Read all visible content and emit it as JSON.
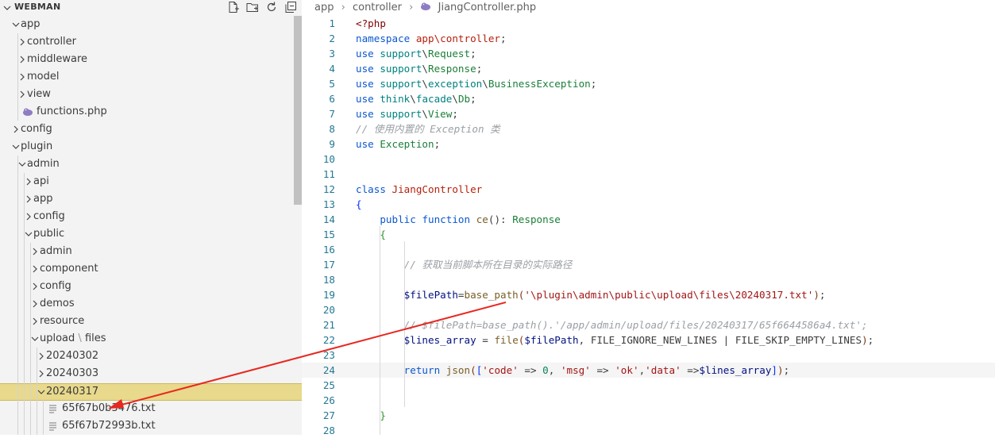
{
  "sidebar": {
    "title": "WEBMAN",
    "header_icons": [
      "new-file-icon",
      "new-folder-icon",
      "refresh-icon",
      "collapse-all-icon"
    ],
    "tree": [
      {
        "label": "app",
        "indent": 0,
        "type": "folder",
        "expanded": true
      },
      {
        "label": "controller",
        "indent": 1,
        "type": "folder",
        "expanded": false
      },
      {
        "label": "middleware",
        "indent": 1,
        "type": "folder",
        "expanded": false
      },
      {
        "label": "model",
        "indent": 1,
        "type": "folder",
        "expanded": false
      },
      {
        "label": "view",
        "indent": 1,
        "type": "folder",
        "expanded": false
      },
      {
        "label": "functions.php",
        "indent": 1,
        "type": "php"
      },
      {
        "label": "config",
        "indent": 0,
        "type": "folder",
        "expanded": false
      },
      {
        "label": "plugin",
        "indent": 0,
        "type": "folder",
        "expanded": true
      },
      {
        "label": "admin",
        "indent": 1,
        "type": "folder",
        "expanded": true
      },
      {
        "label": "api",
        "indent": 2,
        "type": "folder",
        "expanded": false
      },
      {
        "label": "app",
        "indent": 2,
        "type": "folder",
        "expanded": false
      },
      {
        "label": "config",
        "indent": 2,
        "type": "folder",
        "expanded": false
      },
      {
        "label": "public",
        "indent": 2,
        "type": "folder",
        "expanded": true
      },
      {
        "label": "admin",
        "indent": 3,
        "type": "folder",
        "expanded": false
      },
      {
        "label": "component",
        "indent": 3,
        "type": "folder",
        "expanded": false
      },
      {
        "label": "config",
        "indent": 3,
        "type": "folder",
        "expanded": false
      },
      {
        "label": "demos",
        "indent": 3,
        "type": "folder",
        "expanded": false
      },
      {
        "label": "resource",
        "indent": 3,
        "type": "folder",
        "expanded": false
      },
      {
        "label": "upload",
        "label2": "files",
        "indent": 3,
        "type": "folder",
        "expanded": true
      },
      {
        "label": "20240302",
        "indent": 4,
        "type": "folder",
        "expanded": false
      },
      {
        "label": "20240303",
        "indent": 4,
        "type": "folder",
        "expanded": false
      },
      {
        "label": "20240317",
        "indent": 4,
        "type": "folder",
        "expanded": true,
        "selected": true
      },
      {
        "label": "65f67b0b3476.txt",
        "indent": 5,
        "type": "txt"
      },
      {
        "label": "65f67b72993b.txt",
        "indent": 5,
        "type": "txt"
      }
    ]
  },
  "breadcrumb": {
    "items": [
      "app",
      "controller",
      "JiangController.php"
    ]
  },
  "editor": {
    "lines": [
      {
        "n": "1",
        "html": "<span class=\"php\">&lt;?php</span>"
      },
      {
        "n": "2",
        "html": "<span class=\"kb\">namespace</span> <span class=\"cls\">app\\controller</span><span class=\"p\">;</span>"
      },
      {
        "n": "3",
        "html": "<span class=\"kb\">use</span> <span class=\"pk\">support</span><span class=\"p\">\\</span><span class=\"str\">Request</span><span class=\"p\">;</span>"
      },
      {
        "n": "4",
        "html": "<span class=\"kb\">use</span> <span class=\"pk\">support</span><span class=\"p\">\\</span><span class=\"str\">Response</span><span class=\"p\">;</span>"
      },
      {
        "n": "5",
        "html": "<span class=\"kb\">use</span> <span class=\"pk\">support</span><span class=\"p\">\\</span><span class=\"pk\">exception</span><span class=\"p\">\\</span><span class=\"str\">BusinessException</span><span class=\"p\">;</span>"
      },
      {
        "n": "6",
        "html": "<span class=\"kb\">use</span> <span class=\"pk\">think</span><span class=\"p\">\\</span><span class=\"pk\">facade</span><span class=\"p\">\\</span><span class=\"str\">Db</span><span class=\"p\">;</span>"
      },
      {
        "n": "7",
        "html": "<span class=\"kb\">use</span> <span class=\"pk\">support</span><span class=\"p\">\\</span><span class=\"str\">View</span><span class=\"p\">;</span>"
      },
      {
        "n": "8",
        "html": "<span class=\"cmt\">// 使用内置的 Exception 类</span>"
      },
      {
        "n": "9",
        "html": "<span class=\"kb\">use</span> <span class=\"str\">Exception</span><span class=\"p\">;</span>"
      },
      {
        "n": "10",
        "html": ""
      },
      {
        "n": "11",
        "html": ""
      },
      {
        "n": "12",
        "html": "<span class=\"kb\">class</span> <span class=\"cls\">JiangController</span>"
      },
      {
        "n": "13",
        "html": "<span class=\"brace\">{</span>"
      },
      {
        "n": "14",
        "html": "    <span class=\"kb\">public</span> <span class=\"kb\">function</span> <span class=\"fn\">ce</span><span class=\"p\">():</span> <span class=\"str\">Response</span>"
      },
      {
        "n": "15",
        "html": "    <span class=\"brace2\">{</span>"
      },
      {
        "n": "16",
        "html": ""
      },
      {
        "n": "17",
        "html": "        <span class=\"cmt\">// 获取当前脚本所在目录的实际路径</span>"
      },
      {
        "n": "18",
        "html": ""
      },
      {
        "n": "19",
        "html": "        <span class=\"v\">$filePath</span><span class=\"p\">=</span><span class=\"fn\">base_path</span><span class=\"brace3\">(</span><span class=\"s\">'\\plugin\\admin\\public\\upload\\files\\20240317.txt'</span><span class=\"brace3\">)</span><span class=\"p\">;</span>"
      },
      {
        "n": "20",
        "html": ""
      },
      {
        "n": "21",
        "html": "        <span class=\"cmt\">// $filePath=base_path().'/app/admin/upload/files/20240317/65f6644586a4.txt';</span>"
      },
      {
        "n": "22",
        "html": "        <span class=\"v\">$lines_array</span> <span class=\"p\">=</span> <span class=\"fn\">file</span><span class=\"brace3\">(</span><span class=\"v\">$filePath</span><span class=\"p\">,</span> <span class=\"p\">FILE_IGNORE_NEW_LINES</span> <span class=\"p\">|</span> <span class=\"p\">FILE_SKIP_EMPTY_LINES</span><span class=\"brace3\">)</span><span class=\"p\">;</span>"
      },
      {
        "n": "23",
        "html": ""
      },
      {
        "n": "24",
        "html": "        <span class=\"kb\">return</span> <span class=\"fn\">json</span><span class=\"brace3\">(</span><span class=\"brace\">[</span><span class=\"s\">'code'</span> <span class=\"p\">=&gt;</span> <span class=\"n\">0</span><span class=\"p\">,</span> <span class=\"s\">'msg'</span> <span class=\"p\">=&gt;</span> <span class=\"s\">'ok'</span><span class=\"p\">,</span><span class=\"s\">'data'</span> <span class=\"p\">=&gt;</span><span class=\"v\">$lines_array</span><span class=\"brace\">]</span><span class=\"brace3\">)</span><span class=\"p\">;</span>",
        "highlight": true
      },
      {
        "n": "25",
        "html": ""
      },
      {
        "n": "26",
        "html": ""
      },
      {
        "n": "27",
        "html": "    <span class=\"brace2\">}</span>"
      },
      {
        "n": "28",
        "html": ""
      }
    ]
  },
  "colors": {
    "sidebar_bg": "#f3f3f3",
    "selected_row": "#e8d98c",
    "arrow": "#e8271f",
    "line_numbers": "#237893"
  }
}
